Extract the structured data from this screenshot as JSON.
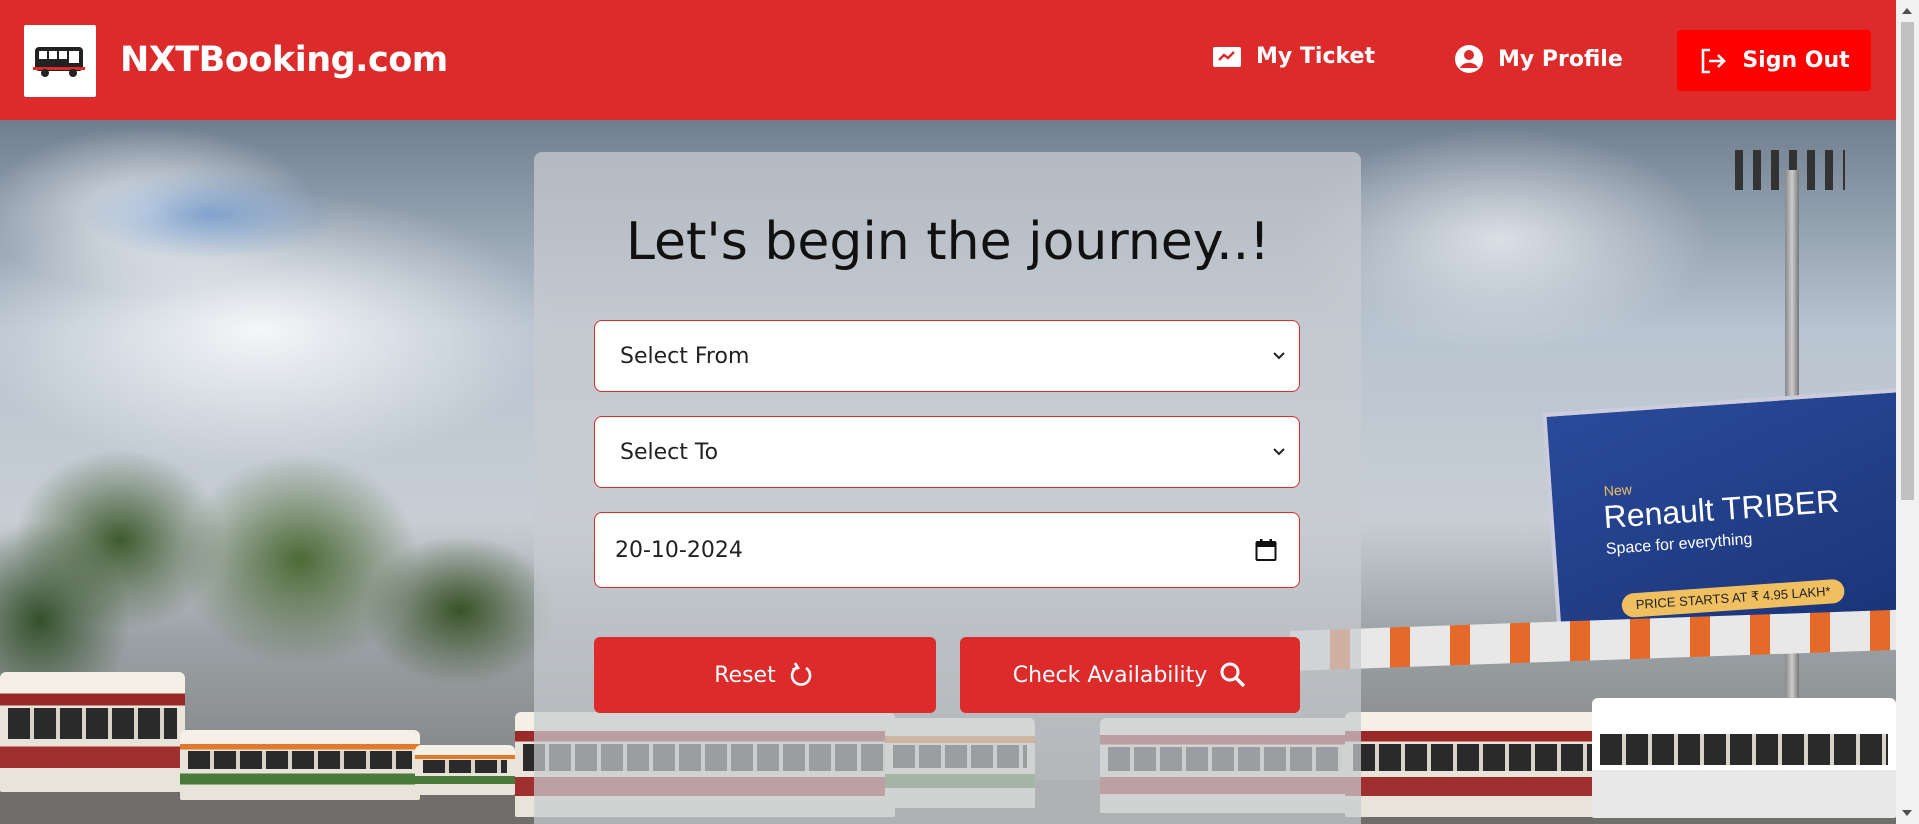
{
  "header": {
    "brand": "NXTBooking.com",
    "logo_icon": "bus-icon",
    "nav": {
      "my_ticket": "My Ticket",
      "my_profile": "My Profile",
      "sign_out": "Sign Out"
    }
  },
  "booking_form": {
    "heading": "Let's begin the journey..!",
    "from_select": "Select From",
    "to_select": "Select To",
    "date_value": "20-10-2024",
    "reset_label": "Reset",
    "check_label": "Check Availability"
  },
  "background": {
    "billboard": {
      "line1": "New",
      "line2": "Renault TRIBER",
      "line3": "Space for everything",
      "line4": "PRICE STARTS AT ₹ 4.95 LAKH*"
    }
  },
  "colors": {
    "primary": "#dd2a2a",
    "signout": "#ff0000"
  }
}
